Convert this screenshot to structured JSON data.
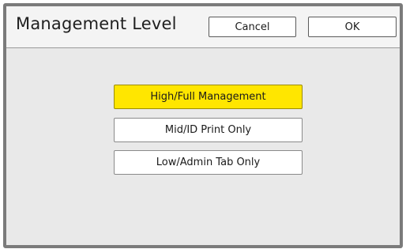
{
  "dialog": {
    "title": "Management Level",
    "cancel_label": "Cancel",
    "ok_label": "OK"
  },
  "options": [
    {
      "label": "High/Full Management",
      "selected": true
    },
    {
      "label": "Mid/ID Print Only",
      "selected": false
    },
    {
      "label": "Low/Admin Tab Only",
      "selected": false
    }
  ],
  "colors": {
    "selected_option": "#ffe600",
    "panel_background": "#e9e9e9",
    "frame_border": "#7b7b7b"
  }
}
